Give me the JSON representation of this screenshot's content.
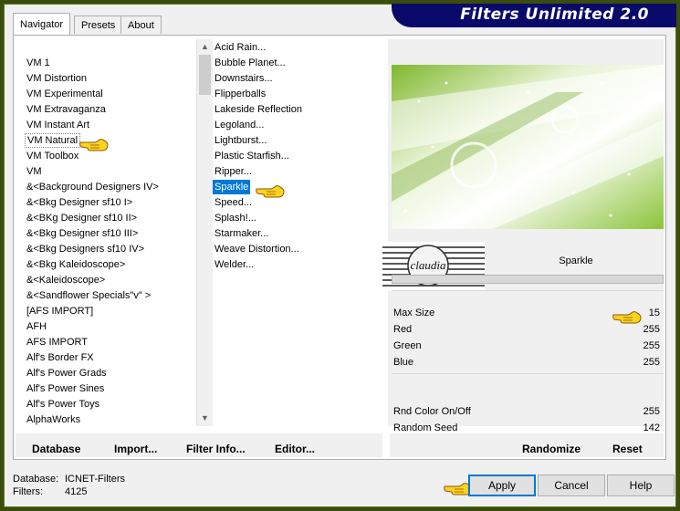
{
  "window": {
    "title": "Filters Unlimited 2.0"
  },
  "tabs": [
    "Navigator",
    "Presets",
    "About"
  ],
  "categories": [
    "VM 1",
    "VM Distortion",
    "VM Experimental",
    "VM Extravaganza",
    "VM Instant Art",
    "VM Natural",
    "VM Toolbox",
    "VM",
    "&<Background Designers IV>",
    "&<Bkg Designer sf10 I>",
    "&<BKg Designer sf10 II>",
    "&<Bkg Designer sf10 III>",
    "&<Bkg Designers sf10 IV>",
    "&<Bkg Kaleidoscope>",
    "&<Kaleidoscope>",
    "&<Sandflower Specials\"v\" >",
    "[AFS IMPORT]",
    "AFH",
    "AFS IMPORT",
    "Alf's Border FX",
    "Alf's Power Grads",
    "Alf's Power Sines",
    "Alf's Power Toys",
    "AlphaWorks"
  ],
  "selected_category": "VM Natural",
  "filters": [
    "Acid Rain...",
    "Bubble Planet...",
    "Downstairs...",
    "Flipperballs",
    "Lakeside Reflection",
    "Legoland...",
    "Lightburst...",
    "Plastic Starfish...",
    "Ripper...",
    "Sparkle",
    "Speed...",
    "Splash!...",
    "Starmaker...",
    "Weave Distortion...",
    "Welder..."
  ],
  "selected_filter": "Sparkle",
  "filter_name": "Sparkle",
  "logo_text": "claudia",
  "params": [
    {
      "label": "Max Size",
      "value": "15"
    },
    {
      "label": "Red",
      "value": "255"
    },
    {
      "label": "Green",
      "value": "255"
    },
    {
      "label": "Blue",
      "value": "255"
    }
  ],
  "params_lower": [
    {
      "label": "Rnd Color On/Off",
      "value": "255"
    },
    {
      "label": "Random Seed",
      "value": "142"
    }
  ],
  "toolbar": {
    "database": "Database",
    "import": "Import...",
    "filter_info": "Filter Info...",
    "editor": "Editor...",
    "randomize": "Randomize",
    "reset": "Reset"
  },
  "info": {
    "database_label": "Database:",
    "database_value": "ICNET-Filters",
    "filters_label": "Filters:",
    "filters_value": "4125"
  },
  "buttons": {
    "apply": "Apply",
    "cancel": "Cancel",
    "help": "Help"
  },
  "colors": {
    "accent": "#0078d7",
    "title_bar": "#0a0a6a",
    "frame": "#3b4d0e",
    "preview_green": "#8bc34a"
  }
}
